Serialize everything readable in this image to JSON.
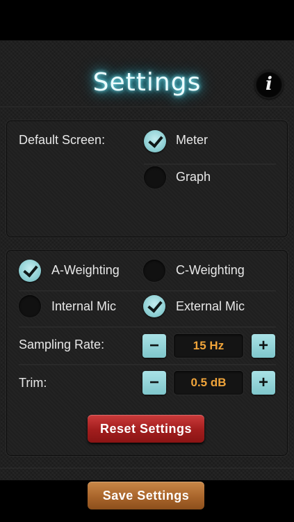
{
  "header": {
    "title": "Settings",
    "info_glyph": "i"
  },
  "default_screen": {
    "label": "Default Screen:",
    "options": [
      {
        "label": "Meter",
        "checked": true
      },
      {
        "label": "Graph",
        "checked": false
      }
    ]
  },
  "weighting": {
    "a_label": "A-Weighting",
    "a_checked": true,
    "c_label": "C-Weighting",
    "c_checked": false
  },
  "microphone": {
    "internal_label": "Internal Mic",
    "internal_checked": false,
    "external_label": "External Mic",
    "external_checked": true
  },
  "sampling_rate": {
    "label": "Sampling Rate:",
    "value": "15 Hz",
    "minus": "−",
    "plus": "+"
  },
  "trim": {
    "label": "Trim:",
    "value": "0.5 dB",
    "minus": "−",
    "plus": "+"
  },
  "buttons": {
    "reset": "Reset Settings",
    "save": "Save Settings"
  },
  "colors": {
    "accent_teal": "#8fd0d4",
    "value_orange": "#f0a43a",
    "reset_red": "#a11d1d",
    "save_bronze": "#a9652b",
    "title_glow": "#39c9e0"
  },
  "icons": {
    "info": "info-icon",
    "check": "checkmark-icon"
  }
}
